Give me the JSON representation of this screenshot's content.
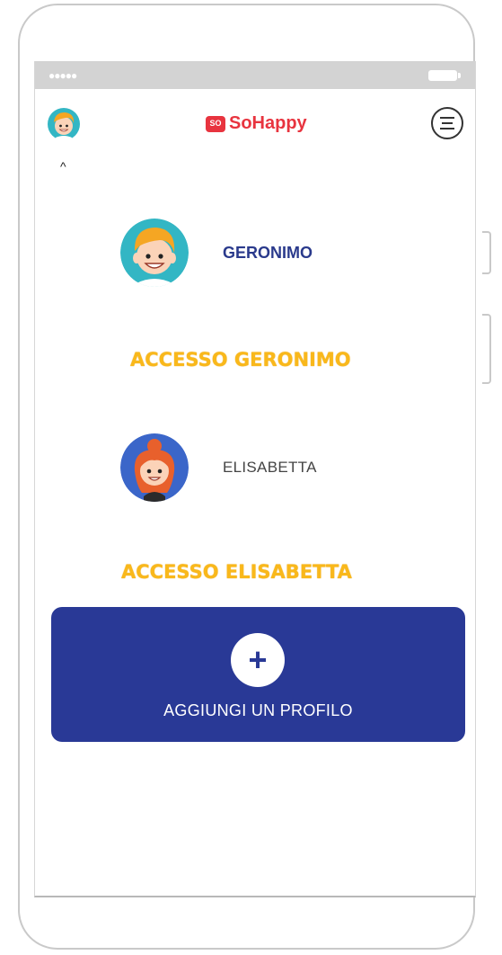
{
  "header": {
    "logo_badge": "SO",
    "logo_text": "SoHappy",
    "caret": "^"
  },
  "status_bar": {
    "signal": "●●●●●"
  },
  "profiles": [
    {
      "name": "GERONIMO",
      "access_label": "ACCESSO GERONIMO"
    },
    {
      "name": "ELISABETTA",
      "access_label": "ACCESSO ELISABETTA"
    }
  ],
  "add_profile": {
    "icon": "+",
    "label": "AGGIUNGI UN PROFILO"
  },
  "colors": {
    "brand_red": "#e8343f",
    "primary_blue": "#293996",
    "accent_yellow": "#f9b81b"
  }
}
